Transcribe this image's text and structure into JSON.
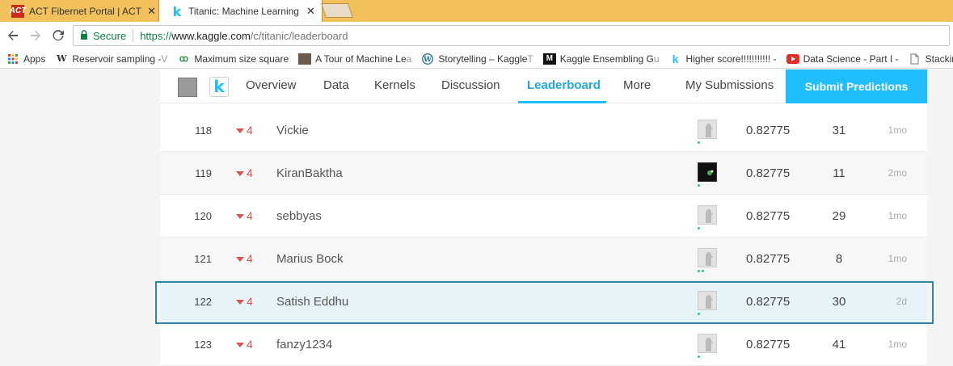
{
  "browser": {
    "tabs": [
      {
        "title": "ACT Fibernet Portal | ACT",
        "icon": "act-favicon",
        "favicon_text": "ACT"
      },
      {
        "title": "Titanic: Machine Learning",
        "icon": "kaggle-favicon",
        "favicon_text": "k",
        "active": true
      }
    ],
    "tab_close": "✕",
    "nav": {
      "back": "back-icon",
      "forward": "forward-icon",
      "reload": "reload-icon"
    },
    "omnibox": {
      "secure_label": "Secure",
      "url_prefix": "https://",
      "url_host": "www.kaggle.com",
      "url_path": "/c/titanic/leaderboard"
    },
    "bookmarks": [
      {
        "label": "Apps",
        "icon": "apps-grid-icon"
      },
      {
        "label": "Reservoir sampling - ",
        "fade": "V",
        "icon": "wikipedia-icon"
      },
      {
        "label": "Maximum size square",
        "fade": "",
        "icon": "geeksforgeeks-icon"
      },
      {
        "label": "A Tour of Machine Le",
        "fade": "a",
        "icon": "site-avatar-icon"
      },
      {
        "label": "Storytelling – Kaggle ",
        "fade": "T",
        "icon": "wordpress-icon"
      },
      {
        "label": "Kaggle Ensembling G",
        "fade": "u",
        "icon": "mlwave-icon"
      },
      {
        "label": "Higher score!!!!!!!!!!! -",
        "fade": "",
        "icon": "kaggle-icon"
      },
      {
        "label": "Data Science - Part I -",
        "fade": "",
        "icon": "youtube-icon"
      },
      {
        "label": "Stacking",
        "fade": "",
        "icon": "document-icon"
      }
    ]
  },
  "sitenav": {
    "links": [
      "Overview",
      "Data",
      "Kernels",
      "Discussion",
      "Leaderboard",
      "More"
    ],
    "active": "Leaderboard",
    "my_submissions": "My Submissions",
    "submit_button": "Submit Predictions",
    "logo_letter": "k"
  },
  "leaderboard": {
    "rows": [
      {
        "rank": "118",
        "change": "4",
        "name": "Vickie",
        "score": "0.82775",
        "entries": "31",
        "last": "1mo",
        "avatar": "default",
        "dots": 1
      },
      {
        "rank": "119",
        "change": "4",
        "name": "KiranBaktha",
        "score": "0.82775",
        "entries": "11",
        "last": "2mo",
        "avatar": "dark",
        "dots": 1
      },
      {
        "rank": "120",
        "change": "4",
        "name": "sebbyas",
        "score": "0.82775",
        "entries": "29",
        "last": "1mo",
        "avatar": "default",
        "dots": 1
      },
      {
        "rank": "121",
        "change": "4",
        "name": "Marius Bock",
        "score": "0.82775",
        "entries": "8",
        "last": "1mo",
        "avatar": "default",
        "dots": 2
      },
      {
        "rank": "122",
        "change": "4",
        "name": "Satish Eddhu",
        "score": "0.82775",
        "entries": "30",
        "last": "2d",
        "avatar": "default",
        "dots": 1,
        "highlight": true
      },
      {
        "rank": "123",
        "change": "4",
        "name": "fanzy1234",
        "score": "0.82775",
        "entries": "41",
        "last": "1mo",
        "avatar": "default",
        "dots": 1
      }
    ]
  },
  "colors": {
    "kaggle_blue": "#20beff",
    "negative_red": "#d9534f",
    "tab_bar": "#f2c15b",
    "secure_green": "#0b8043",
    "highlight_row": "#e6f3f8"
  }
}
